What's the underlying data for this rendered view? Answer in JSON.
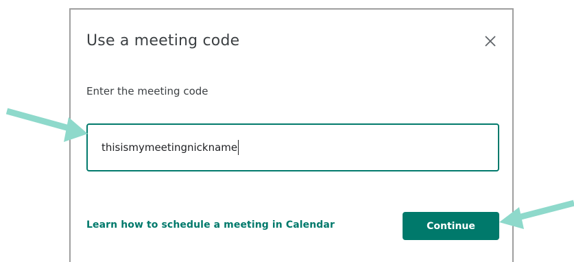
{
  "dialog": {
    "title": "Use a meeting code",
    "close_icon": "close-icon",
    "prompt": "Enter the meeting code",
    "code_value": "thisismymeetingnickname",
    "learn_link": "Learn how to schedule a meeting in Calendar",
    "continue_label": "Continue"
  },
  "annotations": {
    "arrow_color": "#8ed9cb"
  },
  "colors": {
    "accent": "#00796b",
    "text": "#3c4043",
    "border": "#9e9e9e"
  }
}
